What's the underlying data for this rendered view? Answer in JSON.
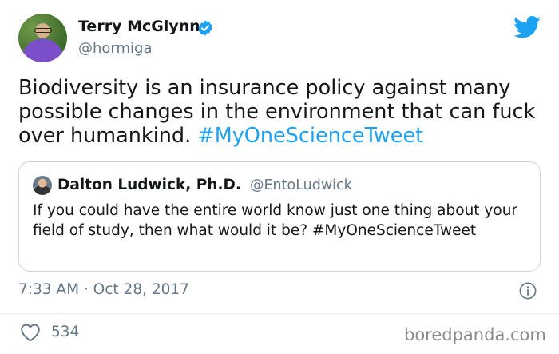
{
  "author": {
    "name": "Terry McGlynn",
    "handle": "@hormiga",
    "verified": true
  },
  "tweet": {
    "text": "Biodiversity is an insurance policy against many possible changes in the environment that can fuck over humankind. ",
    "hashtag": "#MyOneScienceTweet",
    "timestamp": "7:33 AM · Oct 28, 2017",
    "likes": "534"
  },
  "quoted": {
    "name": "Dalton Ludwick, Ph.D.",
    "handle": "@EntoLudwick",
    "text": "If you could have the entire world know just one thing about your field of study, then what would it be? #MyOneScienceTweet"
  },
  "icons": {
    "verified": "verified-badge-icon",
    "bird": "twitter-bird-icon",
    "info": "info-icon",
    "like": "heart-icon"
  },
  "colors": {
    "accent": "#1da1f2",
    "muted": "#657786",
    "text": "#14171a",
    "border": "#ccd6dd"
  },
  "watermark": "boredpanda.com"
}
